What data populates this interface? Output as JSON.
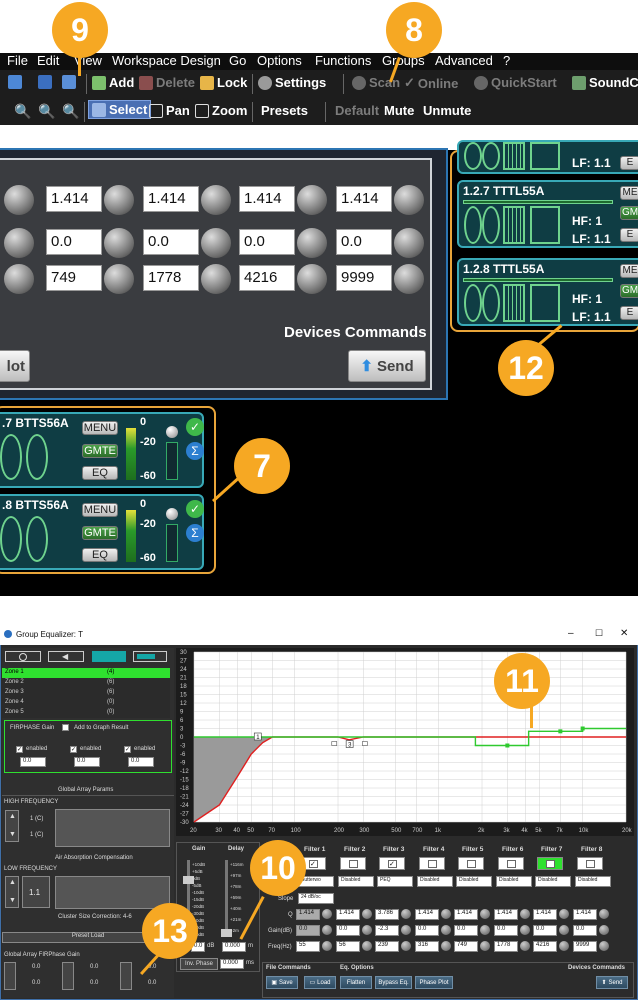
{
  "callouts": {
    "c9": "9",
    "c8": "8",
    "c12": "12",
    "c7": "7",
    "c11": "11",
    "c10": "10",
    "c13": "13"
  },
  "menu": [
    "File",
    "Edit",
    "View",
    "Workspace Design",
    "Go",
    "Options",
    "Functions",
    "Groups",
    "Advanced",
    "?"
  ],
  "toolbar1": {
    "add": "Add",
    "delete": "Delete",
    "lock": "Lock",
    "settings": "Settings",
    "scan": "Scan",
    "online": "Online",
    "quickstart": "QuickStart",
    "soundc": "SoundC"
  },
  "toolbar2": {
    "select": "Select",
    "pan": "Pan",
    "zoom": "Zoom",
    "presets": "Presets",
    "default": "Default",
    "mute": "Mute",
    "unmute": "Unmute"
  },
  "device_panel": {
    "rows": [
      [
        "1.414",
        "1.414",
        "1.414",
        "1.414"
      ],
      [
        "0.0",
        "0.0",
        "0.0",
        "0.0"
      ],
      [
        "749",
        "1778",
        "4216",
        "9999"
      ]
    ],
    "commands_title": "Devices Commands",
    "plot_btn": "lot",
    "send_btn": "Send"
  },
  "right_cards": [
    {
      "title": "",
      "hf": "",
      "lf": "LF: 1.1"
    },
    {
      "title": "1.2.7 TTTL55A",
      "hf": "HF: 1",
      "lf": "LF: 1.1"
    },
    {
      "title": "1.2.8 TTTL55A",
      "hf": "HF: 1",
      "lf": "LF: 1.1"
    }
  ],
  "side_btns": {
    "me": "ME",
    "gm": "GM",
    "e": "E"
  },
  "left_cards": [
    {
      "title": ".7 BTTS56A",
      "menu": "MENU",
      "gmte": "GMTE",
      "eq": "EQ",
      "s0": "0",
      "s20": "-20",
      "s60": "-60"
    },
    {
      "title": ".8 BTTS56A",
      "menu": "MENU",
      "gmte": "GMTE",
      "eq": "EQ",
      "s0": "0",
      "s20": "-20",
      "s60": "-60"
    }
  ],
  "eq_window": {
    "title": "Group Equalizer: T",
    "zones": [
      {
        "name": "Zone 1",
        "count": "(4)"
      },
      {
        "name": "Zone 2",
        "count": "(6)"
      },
      {
        "name": "Zone 3",
        "count": "(6)"
      },
      {
        "name": "Zone 4",
        "count": "(0)"
      },
      {
        "name": "Zone 5",
        "count": "(0)"
      }
    ],
    "firphase_gain": "FIRPHASE Gain",
    "add_to_graph": "Add to Graph Result",
    "enabled": "enabled",
    "zero": "0.0",
    "global_array_params": "Global Array Params",
    "high_freq": "HIGH FREQUENCY",
    "hf_v1": "1 (C)",
    "hf_v2": "1 (C)",
    "air_abs": "Air Absorption Compensation",
    "low_freq": "LOW FREQUENCY",
    "lf_val": "1.1",
    "cluster": "Cluster Size Correction: 4-6",
    "preset_load": "Preset Load",
    "global_fir_gain": "Global Array FIRPhase Gain",
    "gain_label": "Gain",
    "delay_label": "Delay",
    "gain_val": "0.0",
    "db": "dB",
    "delay_val": "0.000",
    "ms": "ms",
    "m": "m",
    "inv_phase": "Inv. Phase",
    "inv_val": "0.000",
    "gain_scale": [
      "+10dB",
      "+5dB",
      "0dB",
      "-5dB",
      "-10dB",
      "-15dB",
      "-20dB",
      "-30dB",
      "-40dB",
      "-50dB",
      "-60dB"
    ],
    "delay_scale": [
      "+116m",
      "+97m",
      "+78m",
      "+59m",
      "+40m",
      "+21m",
      "+2m"
    ],
    "y_ticks": [
      "30",
      "27",
      "24",
      "21",
      "18",
      "15",
      "12",
      "9",
      "6",
      "3",
      "0",
      "-3",
      "-6",
      "-9",
      "-12",
      "-15",
      "-18",
      "-21",
      "-24",
      "-27",
      "-30"
    ],
    "x_ticks": [
      "20",
      "30",
      "40",
      "50",
      "70",
      "100",
      "200",
      "300",
      "500",
      "700",
      "1k",
      "2k",
      "3k",
      "4k",
      "5k",
      "7k",
      "10k",
      "20k"
    ],
    "row_labels": {
      "enabled": "led",
      "type": "Type",
      "slope": "Slope",
      "q": "Q",
      "gain": "Gain(dB)",
      "freq": "Freq(Hz)"
    },
    "filters": [
      {
        "name": "Filter 1",
        "type": "Butterwo",
        "slope": "24 dB/oc",
        "q": "1.414",
        "gain": "0.0",
        "freq": "55",
        "checked": true
      },
      {
        "name": "Filter 2",
        "type": "Disabled",
        "q": "1.414",
        "gain": "0.0",
        "freq": "56",
        "checked": false
      },
      {
        "name": "Filter 3",
        "type": "PEQ",
        "q": "3.786",
        "gain": "-2.3",
        "freq": "239",
        "checked": true
      },
      {
        "name": "Filter 4",
        "type": "Disabled",
        "q": "1.414",
        "gain": "0.0",
        "freq": "316",
        "checked": false
      },
      {
        "name": "Filter 5",
        "type": "Disabled",
        "q": "1.414",
        "gain": "0.0",
        "freq": "749",
        "checked": false
      },
      {
        "name": "Filter 6",
        "type": "Disabled",
        "q": "1.414",
        "gain": "0.0",
        "freq": "1778",
        "checked": false
      },
      {
        "name": "Filter 7",
        "type": "Disabled",
        "q": "1.414",
        "gain": "0.0",
        "freq": "4216",
        "checked": false
      },
      {
        "name": "Filter 8",
        "type": "Disabled",
        "q": "1.414",
        "gain": "0.0",
        "freq": "9999",
        "checked": false
      }
    ],
    "file_commands": "File Commands",
    "save": "Save",
    "load": "Load",
    "eq_options": "Eq. Options",
    "flatten": "Flatten",
    "bypass": "Bypass Eq.",
    "phase_plot": "Phase Plot",
    "devices_commands": "Devices Commands",
    "send": "Send",
    "win_min": "–",
    "win_max": "☐",
    "win_close": "✕",
    "marker1": "1",
    "marker3": "3"
  },
  "colors": {
    "accent": "#f6a823",
    "teal": "#38a9b7",
    "green": "#2fe02f",
    "eqred": "#e02020"
  }
}
